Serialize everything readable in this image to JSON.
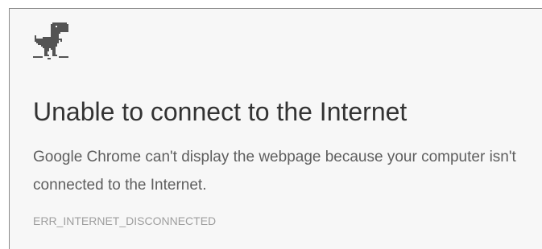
{
  "error_page": {
    "icon": "offline-dino-icon",
    "title": "Unable to connect to the Internet",
    "message": "Google Chrome can't display the webpage because your computer isn't connected to the Internet.",
    "error_code": "ERR_INTERNET_DISCONNECTED"
  },
  "colors": {
    "background": "#f7f7f7",
    "title": "#333333",
    "message": "#5e5e5e",
    "error_code": "#9e9e9e",
    "dino": "#535353"
  }
}
